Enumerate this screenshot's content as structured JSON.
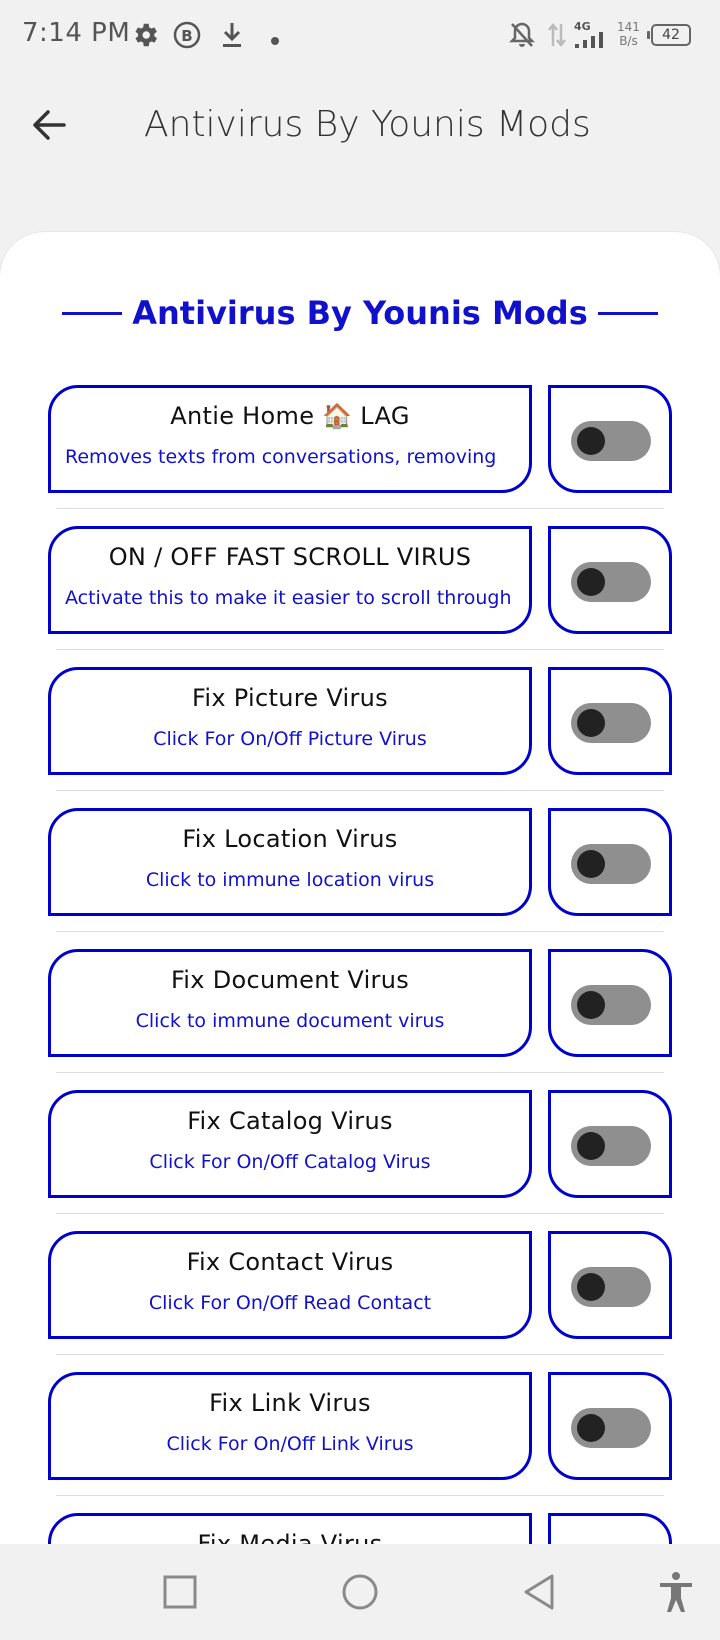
{
  "status_bar": {
    "time": "7:14 PM",
    "network": "4G",
    "net_speed_value": "141",
    "net_speed_unit": "B/s",
    "battery": "42"
  },
  "app_bar": {
    "title": "Antivirus By Younis Mods"
  },
  "card": {
    "header": "Antivirus By Younis Mods"
  },
  "settings": [
    {
      "title": "Antie Home 🏠 LAG",
      "desc": "Removes texts from conversations, removing",
      "enabled": false
    },
    {
      "title": "ON / OFF FAST SCROLL VIRUS",
      "desc": "Activate this to make it easier to scroll through",
      "enabled": false
    },
    {
      "title": "Fix Picture Virus",
      "desc": "Click For On/Off Picture Virus",
      "enabled": false
    },
    {
      "title": "Fix Location Virus",
      "desc": "Click to immune location virus",
      "enabled": false
    },
    {
      "title": "Fix Document Virus",
      "desc": "Click to immune document virus",
      "enabled": false
    },
    {
      "title": "Fix Catalog Virus",
      "desc": "Click For On/Off Catalog Virus",
      "enabled": false
    },
    {
      "title": "Fix Contact Virus",
      "desc": "Click For On/Off Read Contact",
      "enabled": false
    },
    {
      "title": "Fix Link Virus",
      "desc": "Click For On/Off Link Virus",
      "enabled": false
    },
    {
      "title": "Fix Media Virus",
      "desc": "",
      "enabled": false
    }
  ],
  "colors": {
    "accent": "#0000cc",
    "toggle_track": "#8f8f8f",
    "toggle_knob": "#222222"
  }
}
